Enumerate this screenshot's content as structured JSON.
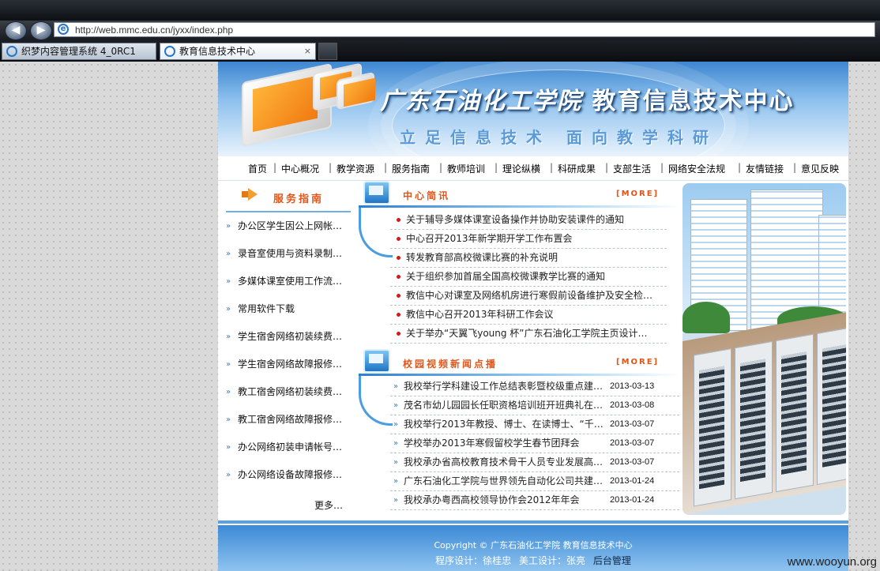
{
  "browser": {
    "url": "http://web.mmc.edu.cn/jyxx/index.php",
    "tabs": [
      {
        "label": "织梦内容管理系统 4_0RC1"
      },
      {
        "label": "教育信息技术中心"
      }
    ],
    "close_label": "×"
  },
  "banner": {
    "school": "广东石油化工学院",
    "center": "教育信息技术中心",
    "slogan": "立足信息技术 面向教学科研"
  },
  "menu": [
    "首页",
    "中心概况",
    "教学资源",
    "服务指南",
    "教师培训",
    "理论纵横",
    "科研成果",
    "支部生活",
    "网络安全法规",
    "友情链接",
    "意见反映"
  ],
  "menu_sep": "|",
  "service": {
    "title": "服务指南",
    "items": [
      "办公区学生因公上网帐…",
      "录音室使用与资料录制…",
      "多媒体课室使用工作流…",
      "常用软件下载",
      "学生宿舍网络初装续费…",
      "学生宿舍网络故障报修…",
      "教工宿舍网络初装续费…",
      "教工宿舍网络故障报修…",
      "办公网络初装申请帐号…",
      "办公网络设备故障报修…"
    ],
    "more": "更多…"
  },
  "news": {
    "title": "中心简讯",
    "more": "[MORE]",
    "items": [
      "关于辅导多媒体课室设备操作并协助安装课件的通知",
      "中心召开2013年新学期开学工作布置会",
      "转发教育部高校微课比赛的补充说明",
      "关于组织参加首届全国高校微课教学比赛的通知",
      "教信中心对课室及网络机房进行寒假前设备维护及安全检…",
      "教信中心召开2013年科研工作会议",
      "关于举办“天翼飞young 杯”广东石油化工学院主页设计…"
    ]
  },
  "videos": {
    "title": "校园视频新闻点播",
    "more": "[MORE]",
    "items": [
      {
        "title": "我校举行学科建设工作总结表彰暨校级重点建…",
        "date": "2013-03-13"
      },
      {
        "title": "茂名市幼儿园园长任职资格培训班开班典礼在…",
        "date": "2013-03-08"
      },
      {
        "title": "我校举行2013年教授、博士、在读博士、“千…",
        "date": "2013-03-07"
      },
      {
        "title": "学校举办2013年寒假留校学生春节团拜会",
        "date": "2013-03-07"
      },
      {
        "title": "我校承办省高校教育技术骨干人员专业发展高…",
        "date": "2013-03-07"
      },
      {
        "title": "广东石油化工学院与世界领先自动化公司共建…",
        "date": "2013-01-24"
      },
      {
        "title": "我校承办粤西高校领导协作会2012年年会",
        "date": "2013-01-24"
      }
    ]
  },
  "footer": {
    "copyright": "Copyright © 广东石油化工学院 教育信息技术中心",
    "program": "程序设计：徐桂忠",
    "art": "美工设计：张亮",
    "admin": "后台管理"
  },
  "watermark": "www.wooyun.org",
  "colors": {
    "accent": "#e0561a",
    "brand_blue": "#3b8ad6",
    "bullet": "#d81818"
  }
}
